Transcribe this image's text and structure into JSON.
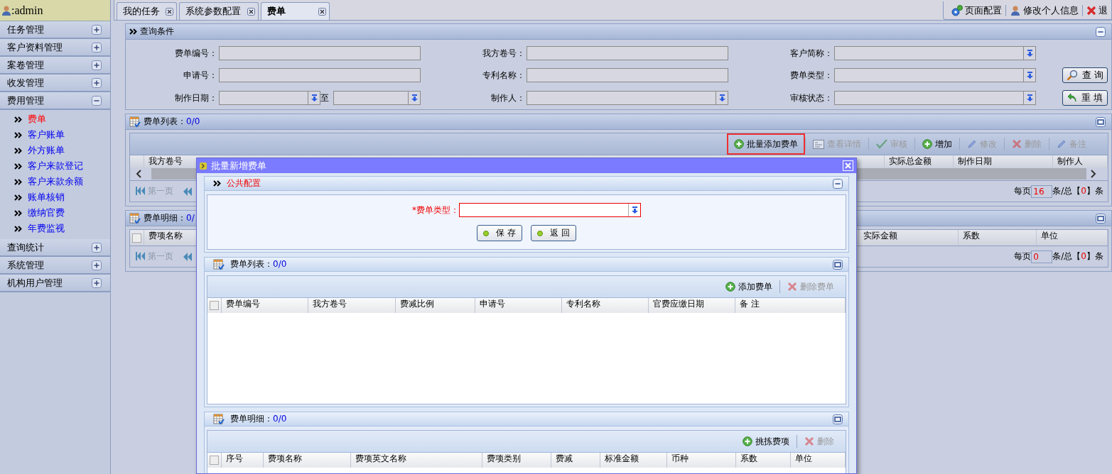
{
  "sidebar": {
    "user": ":admin",
    "items": [
      {
        "label": "任务管理",
        "expanded": false
      },
      {
        "label": "客户资料管理",
        "expanded": false
      },
      {
        "label": "案卷管理",
        "expanded": false
      },
      {
        "label": "收发管理",
        "expanded": false
      },
      {
        "label": "费用管理",
        "expanded": true,
        "children": [
          {
            "label": "费单",
            "selected": true
          },
          {
            "label": "客户账单",
            "selected": false
          },
          {
            "label": "外方账单",
            "selected": false
          },
          {
            "label": "客户来款登记",
            "selected": false
          },
          {
            "label": "客户来款余额",
            "selected": false
          },
          {
            "label": "账单核销",
            "selected": false
          },
          {
            "label": "缴纳官费",
            "selected": false
          },
          {
            "label": "年费监视",
            "selected": false
          }
        ]
      },
      {
        "label": "查询统计",
        "expanded": false
      },
      {
        "label": "系统管理",
        "expanded": false
      },
      {
        "label": "机构用户管理",
        "expanded": false
      }
    ]
  },
  "tabs": [
    {
      "label": "我的任务",
      "selected": false
    },
    {
      "label": "系统参数配置",
      "selected": false
    },
    {
      "label": "费单",
      "selected": true
    }
  ],
  "top_links": [
    {
      "label": "页面配置",
      "kind": "config"
    },
    {
      "label": "修改个人信息",
      "kind": "user"
    },
    {
      "label": "退",
      "kind": "exit"
    }
  ],
  "query": {
    "title": "查询条件",
    "fields": [
      {
        "label": "费单编号：",
        "kind": "text"
      },
      {
        "label": "我方卷号：",
        "kind": "text"
      },
      {
        "label": "客户简称：",
        "kind": "select"
      },
      {
        "label": "申请号：",
        "kind": "text"
      },
      {
        "label": "专利名称：",
        "kind": "text"
      },
      {
        "label": "费单类型：",
        "kind": "select"
      },
      {
        "label": "制作日期：",
        "kind": "daterange",
        "separator": "至"
      },
      {
        "label": "制作人：",
        "kind": "select"
      },
      {
        "label": "审核状态：",
        "kind": "select"
      }
    ],
    "buttons": [
      {
        "label": "查 询",
        "kind": "search"
      },
      {
        "label": "重 填",
        "kind": "reset"
      }
    ]
  },
  "bill_list": {
    "title": "费单列表：",
    "count": "0/0",
    "toolbar": [
      {
        "label": "批量添加费单",
        "kind": "add",
        "disabled": false,
        "highlighted": true
      },
      {
        "label": "查看详情",
        "kind": "view",
        "disabled": true,
        "highlighted": false
      },
      {
        "label": "审核",
        "kind": "approve",
        "disabled": true,
        "highlighted": false
      },
      {
        "label": "增加",
        "kind": "add",
        "disabled": false,
        "highlighted": false
      },
      {
        "label": "修改",
        "kind": "edit",
        "disabled": true,
        "highlighted": false
      },
      {
        "label": "删除",
        "kind": "delete",
        "disabled": true,
        "highlighted": false
      },
      {
        "label": "备注",
        "kind": "edit",
        "disabled": true,
        "highlighted": false
      }
    ],
    "columns_left": [
      "我方卷号"
    ],
    "columns_right": [
      "实际总金额",
      "制作日期",
      "制作人"
    ],
    "pager": {
      "first": "第一页",
      "per_page_label": "每页",
      "per_page": "16",
      "total_prefix": "条/总【",
      "total": "0",
      "total_suffix": "】条"
    }
  },
  "detail": {
    "title": "费单明细：",
    "count": "0/",
    "all_checked": false,
    "columns_left": [
      "费项名称"
    ],
    "columns_right": [
      "实际金额",
      "系数",
      "单位"
    ],
    "pager": {
      "first": "第一页",
      "per_page_label": "每页",
      "per_page": "0",
      "total_prefix": "条/总【",
      "total": "0",
      "total_suffix": "】条"
    }
  },
  "dialog": {
    "title": "批量新增费单",
    "config": {
      "title": "公共配置",
      "field": {
        "label": "*费单类型：",
        "required": true
      },
      "buttons": [
        "保 存",
        "返 回"
      ]
    },
    "list": {
      "title": "费单列表：",
      "count": "0/0",
      "toolbar": [
        {
          "label": "添加费单",
          "kind": "add",
          "disabled": false
        },
        {
          "label": "删除费单",
          "kind": "delete",
          "disabled": true
        }
      ],
      "all_checked": false,
      "columns": [
        "费单编号",
        "我方卷号",
        "费减比例",
        "申请号",
        "专利名称",
        "官费应缴日期",
        "备 注"
      ]
    },
    "detail": {
      "title": "费单明细：",
      "count": "0/0",
      "toolbar": [
        {
          "label": "挑拣费项",
          "kind": "add",
          "disabled": false
        },
        {
          "label": "删除",
          "kind": "delete",
          "disabled": true
        }
      ],
      "all_checked": false,
      "columns": [
        "序号",
        "费项名称",
        "费项英文名称",
        "费项类别",
        "费减",
        "标准金额",
        "币种",
        "系数",
        "单位"
      ]
    }
  }
}
